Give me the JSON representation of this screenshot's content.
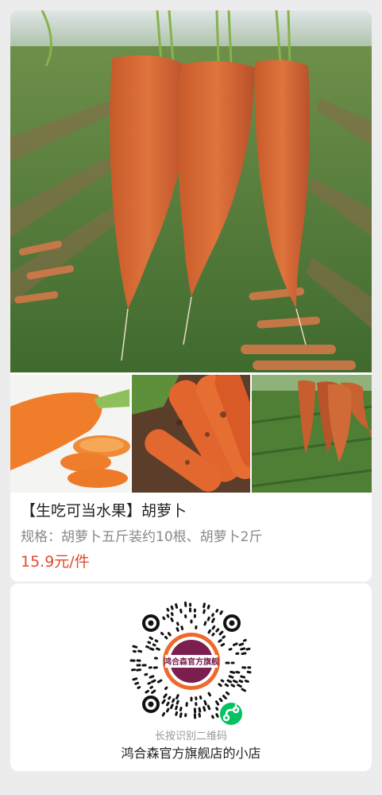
{
  "product": {
    "main_image": "carrots-hanging-over-field-photo",
    "thumbnails": [
      "sliced-carrot-photo",
      "carrots-with-soil-photo",
      "carrots-in-field-photo"
    ],
    "title": "【生吃可当水果】胡萝卜",
    "spec": "规格：胡萝卜五斤装约10根、胡萝卜2斤",
    "price": "15.9元/件"
  },
  "share": {
    "qr_label": "鸿合森官方旗舰",
    "qr_hint": "长按识别二维码",
    "shop_name": "鸿合森官方旗舰店的小店"
  },
  "colors": {
    "price": "#e0492f",
    "carrot": "#d9682e",
    "brand_badge": "#7a1f4e",
    "wechat_green": "#07c160"
  }
}
